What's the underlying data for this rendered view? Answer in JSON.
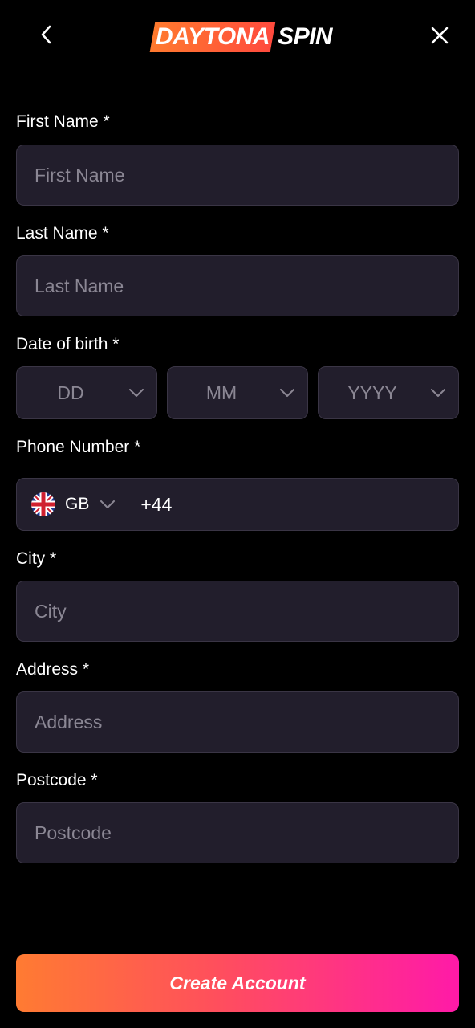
{
  "header": {
    "logo_left": "DAYTONA",
    "logo_right": "SPIN"
  },
  "form": {
    "first_name": {
      "label": "First Name *",
      "placeholder": "First Name"
    },
    "last_name": {
      "label": "Last Name *",
      "placeholder": "Last Name"
    },
    "dob": {
      "label": "Date of birth *",
      "day": "DD",
      "month": "MM",
      "year": "YYYY"
    },
    "phone": {
      "label": "Phone Number *",
      "country_code": "GB",
      "value": "+44"
    },
    "city": {
      "label": "City *",
      "placeholder": "City"
    },
    "address": {
      "label": "Address *",
      "placeholder": "Address"
    },
    "postcode": {
      "label": "Postcode *",
      "placeholder": "Postcode"
    }
  },
  "cta": {
    "label": "Create Account"
  },
  "colors": {
    "background": "#000000",
    "field_bg": "#221e2c",
    "field_border": "#3a3545",
    "placeholder": "#8b8794",
    "cta_start": "#ff7b32",
    "cta_end": "#ff1aa8"
  },
  "icons": [
    "chevron-left-icon",
    "close-icon",
    "chevron-down-icon",
    "uk-flag-icon"
  ]
}
